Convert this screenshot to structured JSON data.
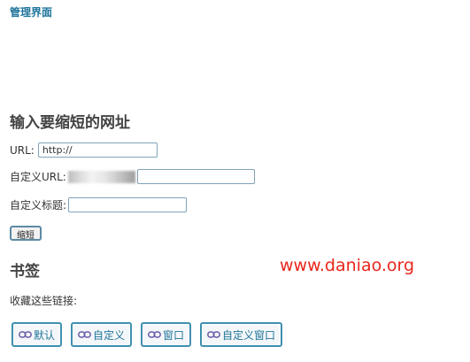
{
  "nav": {
    "admin_link": "管理界面"
  },
  "shorten": {
    "title": "输入要缩短的网址",
    "url_label": "URL:",
    "url_value": "http://",
    "custom_url_label": "自定义URL:",
    "custom_url_value": "",
    "custom_title_label": "自定义标题:",
    "custom_title_value": "",
    "submit_label": "缩短"
  },
  "watermark": "www.daniao.org",
  "bookmarks": {
    "title": "书签",
    "description": "收藏这些链接:",
    "items": [
      {
        "label": "默认"
      },
      {
        "label": "自定义"
      },
      {
        "label": "窗口"
      },
      {
        "label": "自定义窗口"
      }
    ]
  },
  "colors": {
    "link": "#21759b",
    "watermark": "#e8261c",
    "icon": "#6a5aa8"
  }
}
